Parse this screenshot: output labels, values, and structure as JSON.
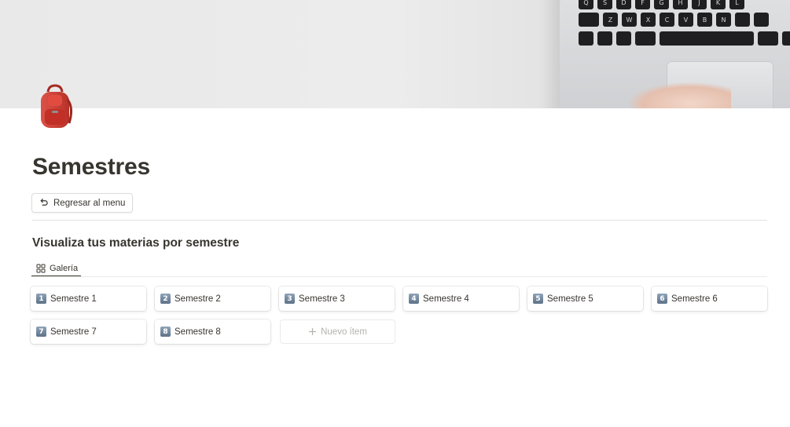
{
  "page": {
    "title": "Semestres",
    "icon": "backpack-icon"
  },
  "cover": {
    "description_icon": "laptop-keyboard-cover-image"
  },
  "keyboard": {
    "row1": [
      "Q",
      "S",
      "D",
      "F",
      "G",
      "H",
      "J",
      "K",
      "L"
    ],
    "row2": [
      "Z",
      "W",
      "X",
      "C",
      "V",
      "B",
      "N"
    ]
  },
  "back_button": {
    "label": "Regresar al menu",
    "icon": "undo-arrow-icon"
  },
  "section": {
    "heading": "Visualiza tus materias por semestre"
  },
  "view": {
    "tab_label": "Galería",
    "tab_icon": "gallery-grid-icon"
  },
  "gallery": {
    "cards": [
      {
        "num": "1",
        "label": "Semestre 1"
      },
      {
        "num": "2",
        "label": "Semestre 2"
      },
      {
        "num": "3",
        "label": "Semestre 3"
      },
      {
        "num": "4",
        "label": "Semestre 4"
      },
      {
        "num": "5",
        "label": "Semestre 5"
      },
      {
        "num": "6",
        "label": "Semestre 6"
      },
      {
        "num": "7",
        "label": "Semestre 7"
      },
      {
        "num": "8",
        "label": "Semestre 8"
      }
    ],
    "new_item_label": "Nuevo ítem"
  },
  "colors": {
    "text": "#37352f",
    "muted": "#b3b2ae",
    "number_badge": "#6f84a0"
  }
}
